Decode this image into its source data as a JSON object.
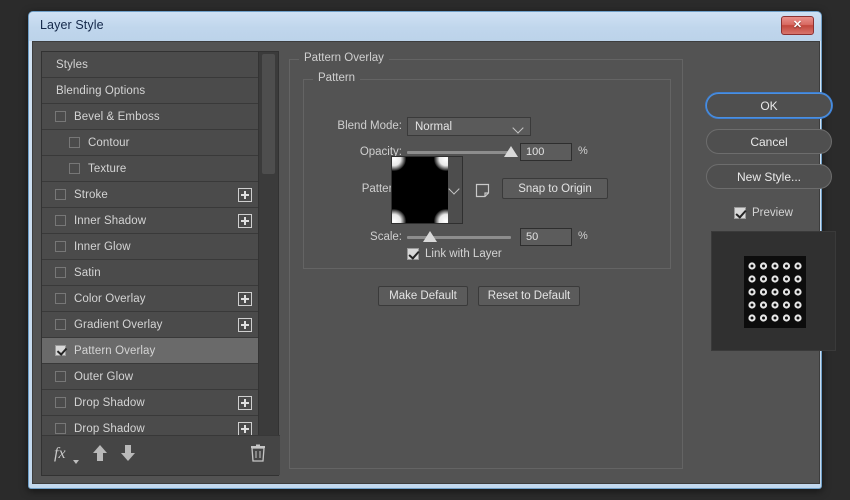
{
  "window": {
    "title": "Layer Style",
    "close_icon": "close-icon",
    "close_label": "✕"
  },
  "styles_panel": {
    "rows": [
      {
        "label": "Styles",
        "type": "header",
        "checkbox": null,
        "plus": false
      },
      {
        "label": "Blending Options",
        "type": "header",
        "checkbox": null,
        "plus": false
      },
      {
        "label": "Bevel & Emboss",
        "type": "item",
        "checkbox": false,
        "plus": false
      },
      {
        "label": "Contour",
        "type": "sub",
        "checkbox": false,
        "plus": false
      },
      {
        "label": "Texture",
        "type": "sub",
        "checkbox": false,
        "plus": false
      },
      {
        "label": "Stroke",
        "type": "item",
        "checkbox": false,
        "plus": true
      },
      {
        "label": "Inner Shadow",
        "type": "item",
        "checkbox": false,
        "plus": true
      },
      {
        "label": "Inner Glow",
        "type": "item",
        "checkbox": false,
        "plus": false
      },
      {
        "label": "Satin",
        "type": "item",
        "checkbox": false,
        "plus": false
      },
      {
        "label": "Color Overlay",
        "type": "item",
        "checkbox": false,
        "plus": true
      },
      {
        "label": "Gradient Overlay",
        "type": "item",
        "checkbox": false,
        "plus": true
      },
      {
        "label": "Pattern Overlay",
        "type": "item",
        "checkbox": true,
        "plus": false,
        "selected": true
      },
      {
        "label": "Outer Glow",
        "type": "item",
        "checkbox": false,
        "plus": false
      },
      {
        "label": "Drop Shadow",
        "type": "item",
        "checkbox": false,
        "plus": true
      },
      {
        "label": "Drop Shadow",
        "type": "item",
        "checkbox": false,
        "plus": true
      }
    ],
    "footer": {
      "fx_label": "fx",
      "fx_icon": "fx-icon",
      "move_up_icon": "arrow-up-icon",
      "move_down_icon": "arrow-down-icon",
      "delete_icon": "trash-icon"
    }
  },
  "main_panel": {
    "group_title": "Pattern Overlay",
    "sub_group_title": "Pattern",
    "blend_mode": {
      "label": "Blend Mode:",
      "value": "Normal",
      "chevron_icon": "chevron-down-icon"
    },
    "opacity": {
      "label": "Opacity:",
      "value": "100",
      "unit": "%",
      "slider_percent": 100
    },
    "pattern": {
      "label": "Pattern:",
      "swatch_icon": "pattern-swatch",
      "picker_chevron_icon": "chevron-down-icon",
      "new_preset_icon": "new-preset-icon",
      "snap_button": "Snap to Origin"
    },
    "scale": {
      "label": "Scale:",
      "value": "50",
      "unit": "%",
      "slider_percent": 22
    },
    "link_with_layer": {
      "label": "Link with Layer",
      "checked": true
    },
    "make_default": "Make Default",
    "reset_to_default": "Reset to Default"
  },
  "right_panel": {
    "ok": "OK",
    "cancel": "Cancel",
    "new_style": "New Style...",
    "preview": {
      "label": "Preview",
      "checked": true
    },
    "preview_thumb_icon": "preview-thumbnail"
  },
  "colors": {
    "dialog_bg": "#535353",
    "panel_bg": "#454545",
    "row_bg": "#4b4b4b",
    "row_selected": "#6a6a6a",
    "accent_focus": "#4a90e2",
    "title_bar": "#c3d9ef",
    "close_red": "#c2463c",
    "text": "#d4d4d4"
  }
}
